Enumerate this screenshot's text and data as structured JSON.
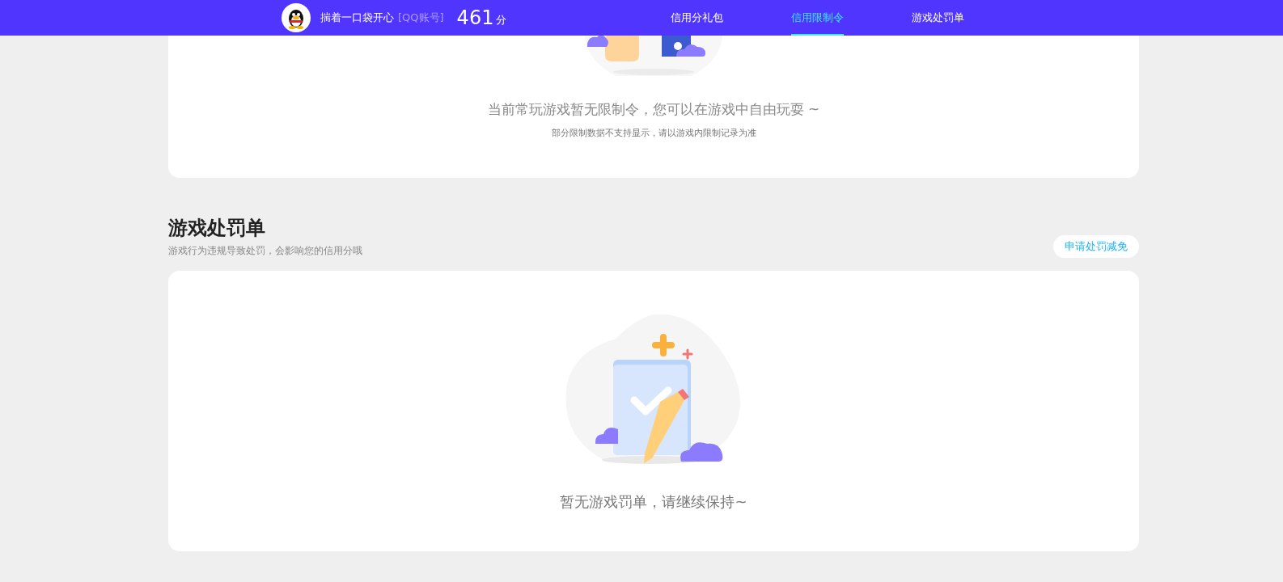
{
  "header": {
    "username": "揣着一口袋开心",
    "account_type": "[QQ账号]",
    "score": "461",
    "score_unit": "分",
    "nav": [
      {
        "label": "信用分礼包",
        "selected": false
      },
      {
        "label": "信用限制令",
        "selected": true
      },
      {
        "label": "游戏处罚单",
        "selected": false
      }
    ]
  },
  "restriction_card": {
    "message": "当前常玩游戏暂无限制令，您可以在游戏中自由玩耍 ~",
    "note": "部分限制数据不支持显示，请以游戏内限制记录为准"
  },
  "penalty_section": {
    "title": "游戏处罚单",
    "subtitle": "游戏行为违规导致处罚，会影响您的信用分哦",
    "action": "申请处罚减免",
    "empty_message": "暂无游戏罚单，请继续保持~"
  }
}
